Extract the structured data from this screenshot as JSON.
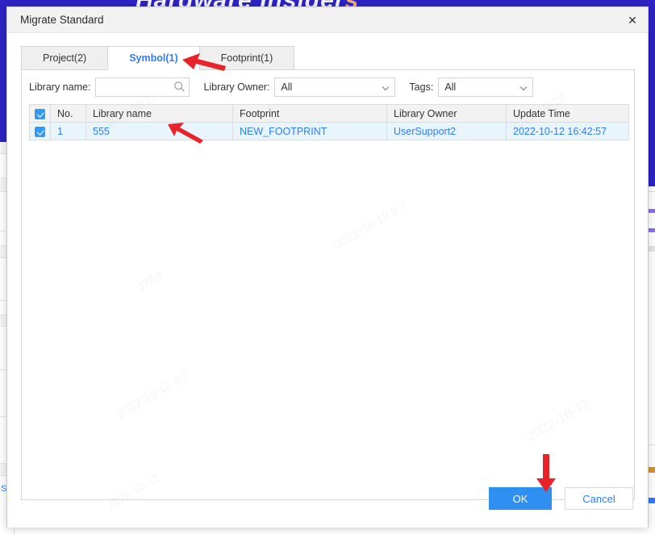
{
  "background": {
    "banner_text_main": "Hardware Insider",
    "banner_text_accent": "s",
    "left_link": "Sec"
  },
  "dialog": {
    "title": "Migrate Standard",
    "close_icon": "close-icon",
    "tabs": [
      {
        "label": "Project(2)",
        "active": false
      },
      {
        "label": "Symbol(1)",
        "active": true
      },
      {
        "label": "Footprint(1)",
        "active": false
      }
    ],
    "filters": {
      "library_name_label": "Library name:",
      "library_name_value": "",
      "library_name_placeholder": "",
      "search_icon": "search-icon",
      "library_owner_label": "Library Owner:",
      "library_owner_value": "All",
      "tags_label": "Tags:",
      "tags_value": "All",
      "chevron_icon": "chevron-down-icon"
    },
    "table": {
      "header_checkbox_checked": true,
      "columns": [
        "",
        "No.",
        "Library name",
        "Footprint",
        "Library Owner",
        "Update Time"
      ],
      "rows": [
        {
          "checked": true,
          "no": "1",
          "library_name": "555",
          "footprint": "NEW_FOOTPRINT",
          "library_owner": "UserSupport2",
          "update_time": "2022-10-12 16:42:57"
        }
      ]
    },
    "footer": {
      "ok_label": "OK",
      "cancel_label": "Cancel"
    }
  },
  "annotations": {
    "arrow_tab": "red-arrow-pointing-to-symbol-tab",
    "arrow_row": "red-arrow-pointing-to-library-name-cell",
    "arrow_ok": "red-arrow-pointing-to-ok-button"
  },
  "watermarks": [
    "2022-10-12",
    "J764",
    "2022-10-12 0.7",
    "2022-10-12"
  ],
  "colors": {
    "accent_blue": "#2f7dff",
    "primary_button": "#2f90f2",
    "row_highlight": "#e8f5fd",
    "banner": "#2d23c4",
    "annotation_red": "#e8232a"
  }
}
